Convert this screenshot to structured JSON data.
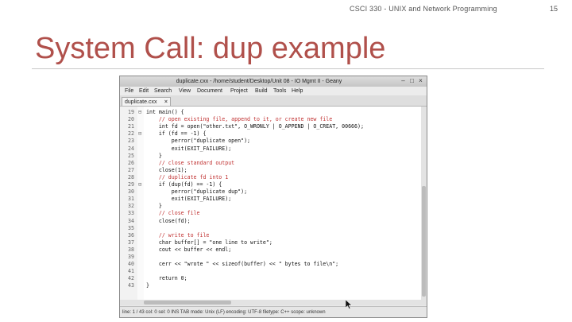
{
  "slide": {
    "header": "CSCI 330 - UNIX and Network Programming",
    "page_number": "15",
    "title": "System Call: dup example"
  },
  "window": {
    "title": "duplicate.cxx - /home/student/Desktop/Unit 08 - IO Mgmt II - Geany",
    "minimize": "–",
    "maximize": "□",
    "close": "×"
  },
  "menu": [
    "File",
    "Edit",
    "Search",
    "View",
    "Document",
    "Project",
    "Build",
    "Tools",
    "Help"
  ],
  "tab": {
    "label": "duplicate.cxx",
    "close": "×"
  },
  "code_lines": [
    {
      "n": "19",
      "fold": "⊟",
      "text": "int main() {",
      "cls": ""
    },
    {
      "n": "20",
      "fold": "",
      "text": "    // open existing file, append to it, or create new file",
      "cls": "comment"
    },
    {
      "n": "21",
      "fold": "",
      "text": "    int fd = open(\"other.txt\", O_WRONLY | O_APPEND | O_CREAT, 00666);",
      "cls": ""
    },
    {
      "n": "22",
      "fold": "⊟",
      "text": "    if (fd == -1) {",
      "cls": ""
    },
    {
      "n": "23",
      "fold": "",
      "text": "        perror(\"duplicate open\");",
      "cls": ""
    },
    {
      "n": "24",
      "fold": "",
      "text": "        exit(EXIT_FAILURE);",
      "cls": ""
    },
    {
      "n": "25",
      "fold": "",
      "text": "    }",
      "cls": ""
    },
    {
      "n": "26",
      "fold": "",
      "text": "    // close standard output",
      "cls": "comment"
    },
    {
      "n": "27",
      "fold": "",
      "text": "    close(1);",
      "cls": ""
    },
    {
      "n": "28",
      "fold": "",
      "text": "    // duplicate fd into 1",
      "cls": "comment"
    },
    {
      "n": "29",
      "fold": "⊟",
      "text": "    if (dup(fd) == -1) {",
      "cls": ""
    },
    {
      "n": "30",
      "fold": "",
      "text": "        perror(\"duplicate dup\");",
      "cls": ""
    },
    {
      "n": "31",
      "fold": "",
      "text": "        exit(EXIT_FAILURE);",
      "cls": ""
    },
    {
      "n": "32",
      "fold": "",
      "text": "    }",
      "cls": ""
    },
    {
      "n": "33",
      "fold": "",
      "text": "    // close file",
      "cls": "comment"
    },
    {
      "n": "34",
      "fold": "",
      "text": "    close(fd);",
      "cls": ""
    },
    {
      "n": "35",
      "fold": "",
      "text": "",
      "cls": ""
    },
    {
      "n": "36",
      "fold": "",
      "text": "    // write to file",
      "cls": "comment"
    },
    {
      "n": "37",
      "fold": "",
      "text": "    char buffer[] = \"one line to write\";",
      "cls": ""
    },
    {
      "n": "38",
      "fold": "",
      "text": "    cout << buffer << endl;",
      "cls": ""
    },
    {
      "n": "39",
      "fold": "",
      "text": "",
      "cls": ""
    },
    {
      "n": "40",
      "fold": "",
      "text": "    cerr << \"wrote \" << sizeof(buffer) << \" bytes to file\\n\";",
      "cls": ""
    },
    {
      "n": "41",
      "fold": "",
      "text": "",
      "cls": ""
    },
    {
      "n": "42",
      "fold": "",
      "text": "    return 0;",
      "cls": ""
    },
    {
      "n": "43",
      "fold": "",
      "text": "}",
      "cls": ""
    }
  ],
  "status": "line: 1 / 43    col: 0    sel: 0    INS    TAB    mode: Unix (LF)    encoding: UTF-8    filetype: C++    scope: unknown",
  "cursor_icon": "mouse-pointer-icon"
}
